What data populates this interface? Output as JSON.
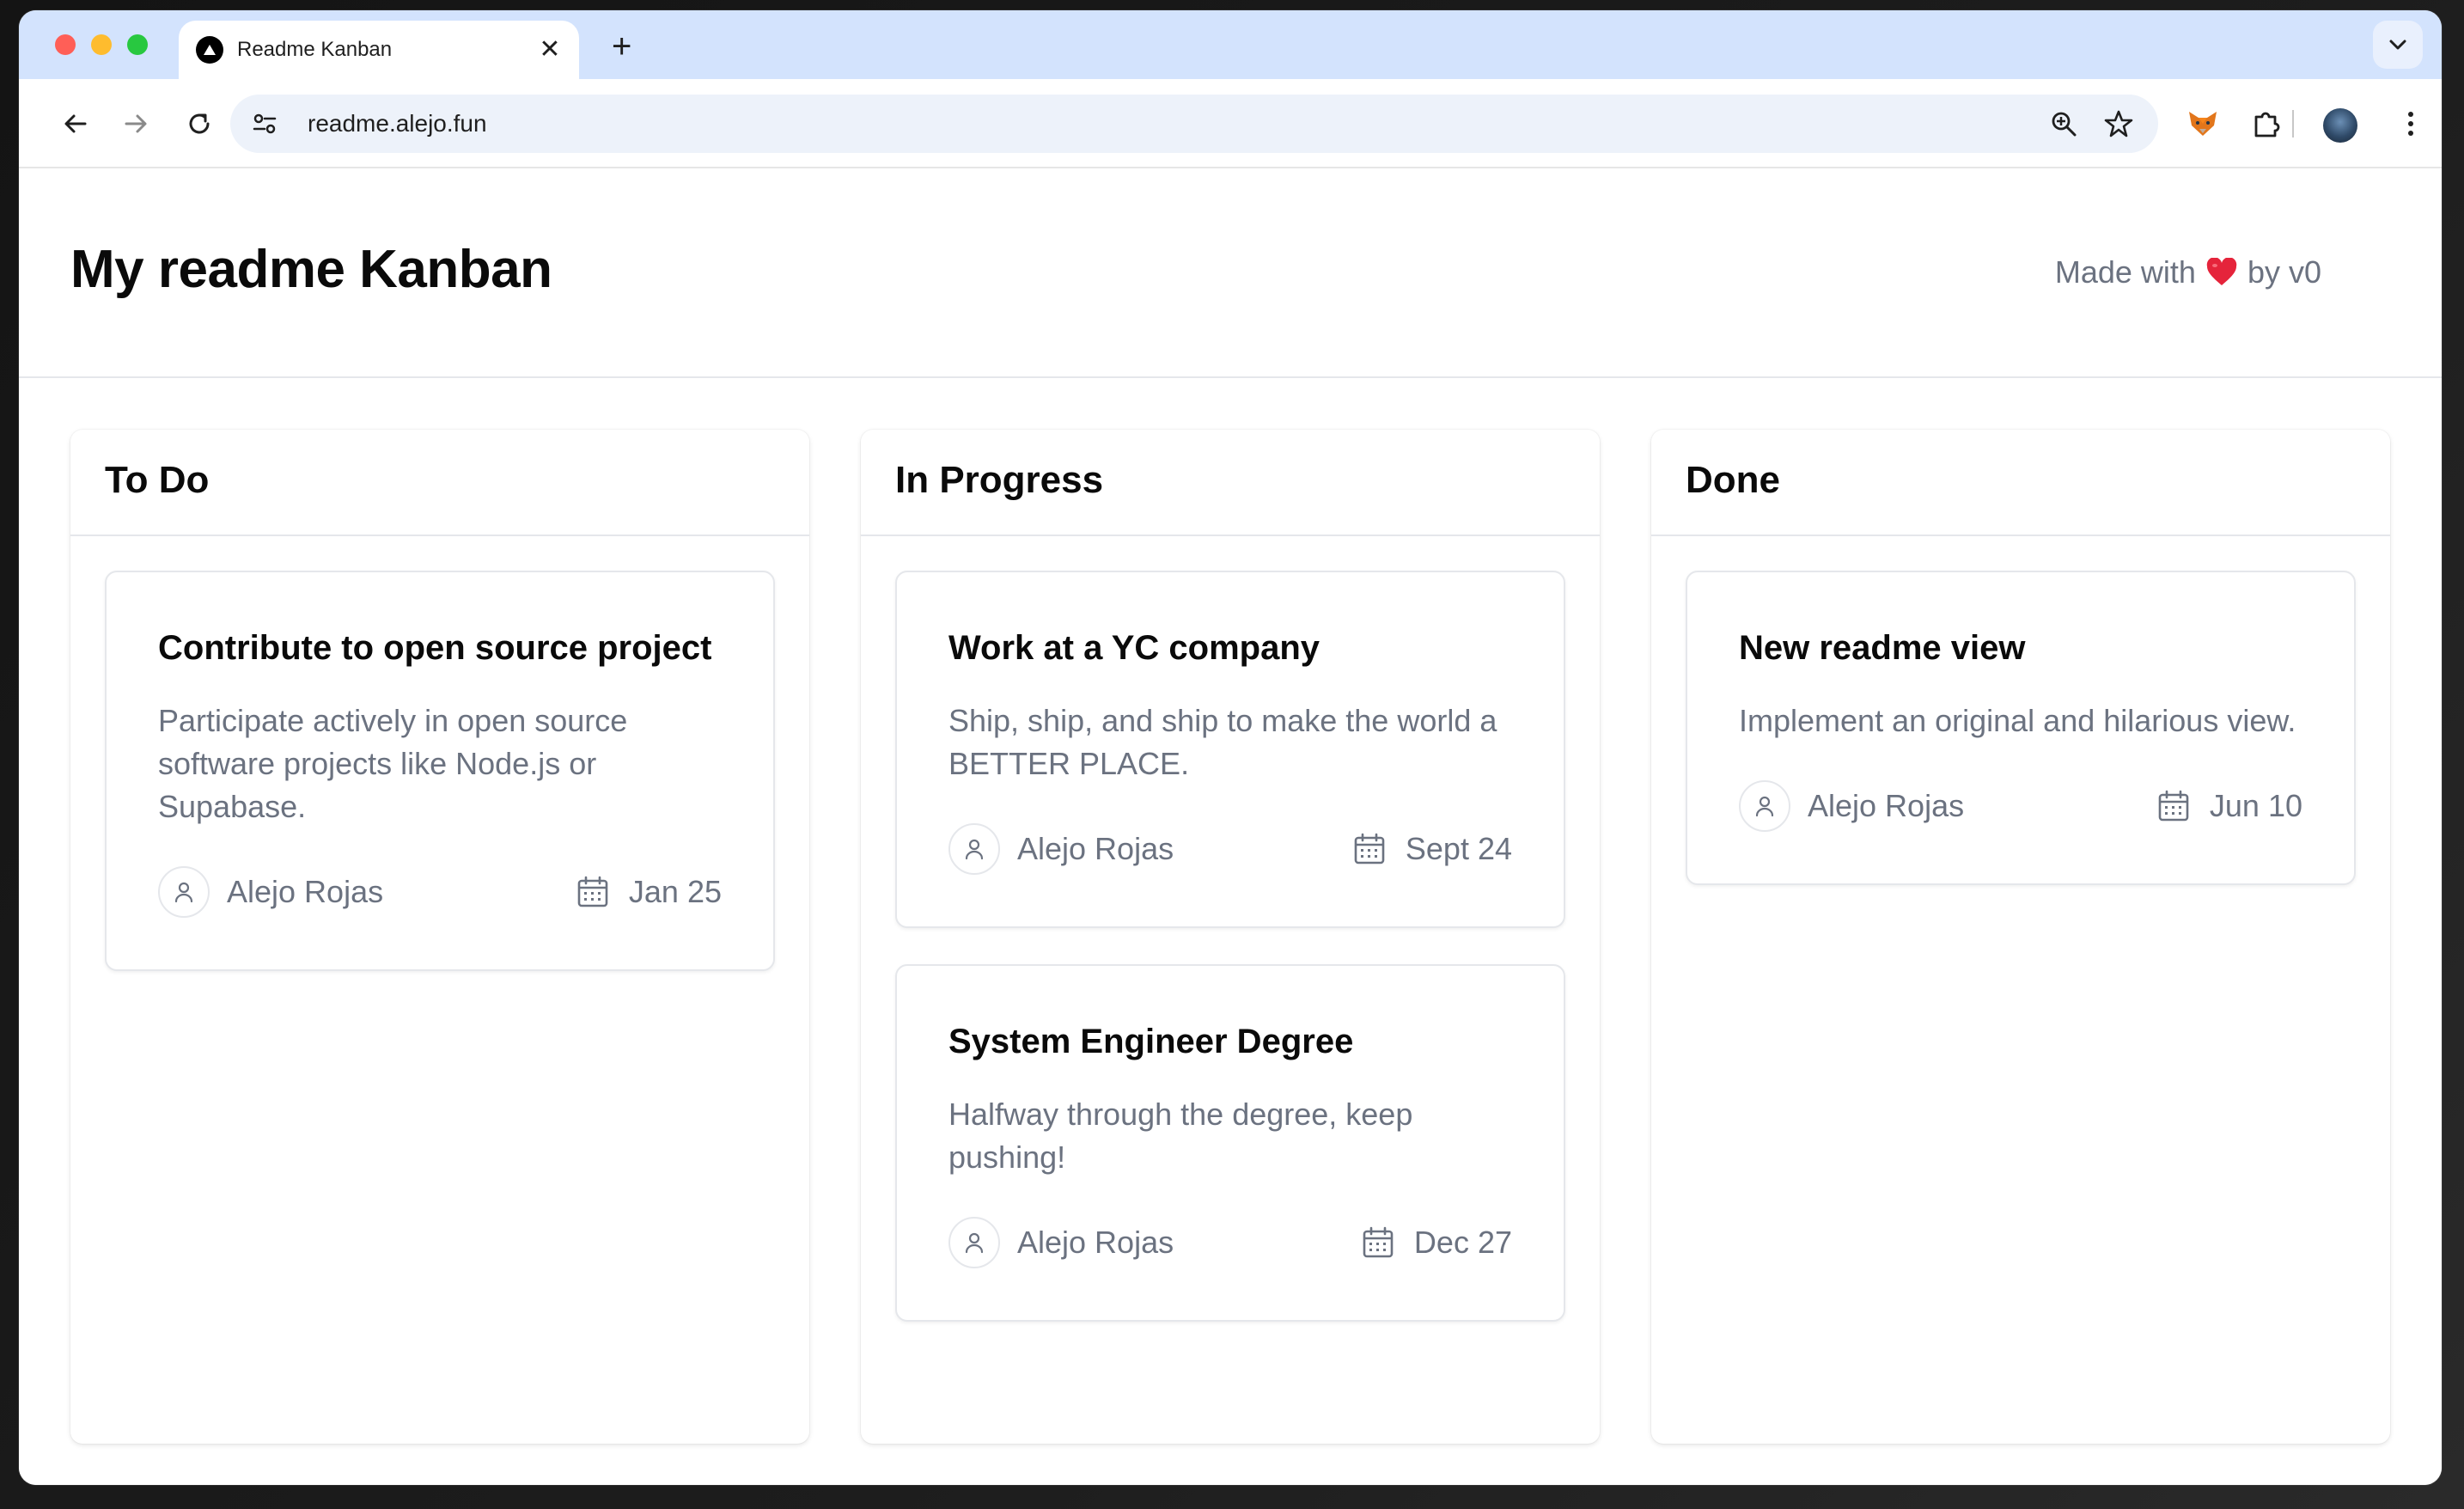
{
  "browser": {
    "tab_title": "Readme Kanban",
    "tab_close": "✕",
    "new_tab": "+",
    "url": "readme.alejo.fun"
  },
  "page": {
    "title": "My readme Kanban",
    "made_with_prefix": "Made with",
    "made_with_suffix": "by v0"
  },
  "colors": {
    "heart": "#e5243b",
    "muted_text": "#6b7280",
    "tab_strip": "#d3e3fd"
  },
  "columns": [
    {
      "title": "To Do",
      "cards": [
        {
          "title": "Contribute to open source project",
          "description": "Participate actively in open source software projects like Node.js or Supabase.",
          "assignee": "Alejo Rojas",
          "date": "Jan 25"
        }
      ]
    },
    {
      "title": "In Progress",
      "cards": [
        {
          "title": "Work at a YC company",
          "description": "Ship, ship, and ship to make the world a BETTER PLACE.",
          "assignee": "Alejo Rojas",
          "date": "Sept 24"
        },
        {
          "title": "System Engineer Degree",
          "description": "Halfway through the degree, keep pushing!",
          "assignee": "Alejo Rojas",
          "date": "Dec 27"
        }
      ]
    },
    {
      "title": "Done",
      "cards": [
        {
          "title": "New readme view",
          "description": "Implement an original and hilarious view.",
          "assignee": "Alejo Rojas",
          "date": "Jun 10"
        }
      ]
    }
  ]
}
